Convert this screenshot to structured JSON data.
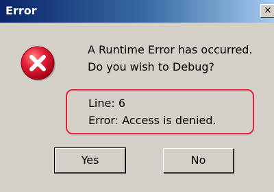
{
  "window": {
    "title": "Error",
    "close_glyph": "×"
  },
  "icon": {
    "name": "error-icon",
    "color": "#e8223c"
  },
  "message": {
    "line1": "A Runtime Error has occurred.",
    "line2": "Do you wish to Debug?"
  },
  "details": {
    "line": "Line: 6",
    "error": "Error: Access is denied.",
    "highlight_color": "#e8223c"
  },
  "buttons": {
    "yes_label": "Yes",
    "no_label": "No"
  }
}
